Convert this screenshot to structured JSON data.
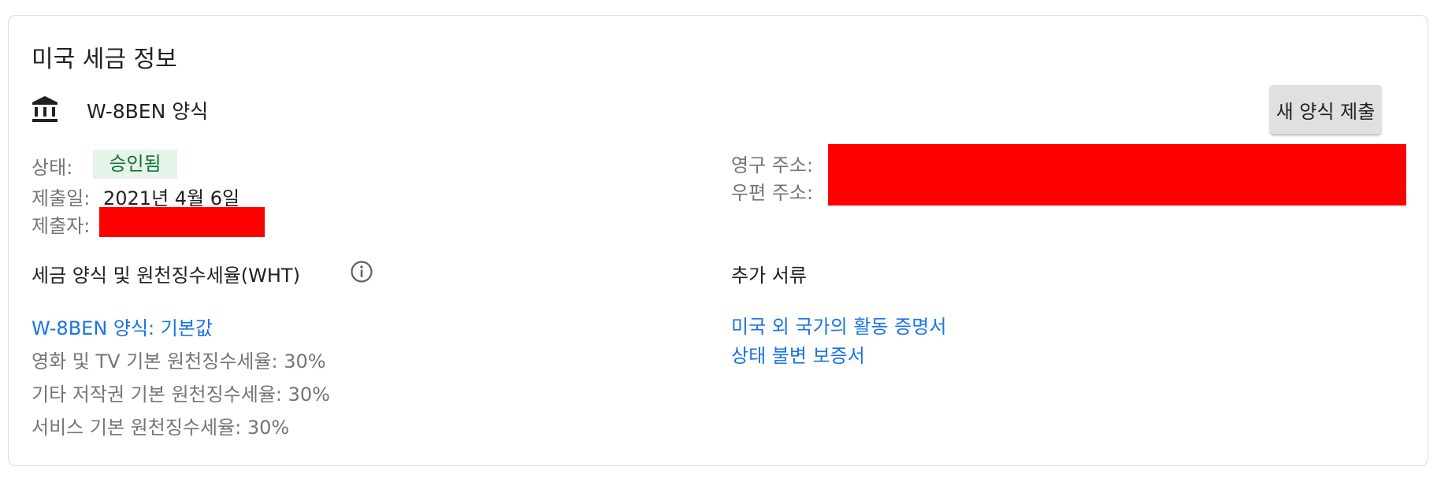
{
  "card": {
    "title": "미국 세금 정보",
    "form": {
      "icon": "bank-icon",
      "name": "W-8BEN 양식",
      "submit_new_label": "새 양식 제출"
    },
    "details": {
      "status_label": "상태:",
      "status_value": "승인됨",
      "submitted_date_label": "제출일:",
      "submitted_date_value": "2021년 4월 6일",
      "submitter_label": "제출자:",
      "permanent_address_label": "영구 주소:",
      "mailing_address_label": "우편 주소:"
    },
    "tax_section": {
      "heading": "세금 양식 및 원천징수세율(WHT)",
      "info_icon": "info-icon",
      "form_link": "W-8BEN 양식: 기본값",
      "rates": [
        "영화 및 TV 기본 원천징수세율: 30%",
        "기타 저작권 기본 원천징수세율: 30%",
        "서비스 기본 원천징수세율: 30%"
      ]
    },
    "additional_docs": {
      "heading": "추가 서류",
      "links": [
        "미국 외 국가의 활동 증명서",
        "상태 불변 보증서"
      ]
    }
  },
  "colors": {
    "link": "#1a73e8",
    "status_badge_bg": "#e6f4ea",
    "status_badge_text": "#137333",
    "redaction": "#ff0000",
    "button_bg": "#e0e0e0",
    "muted_text": "#757575"
  }
}
